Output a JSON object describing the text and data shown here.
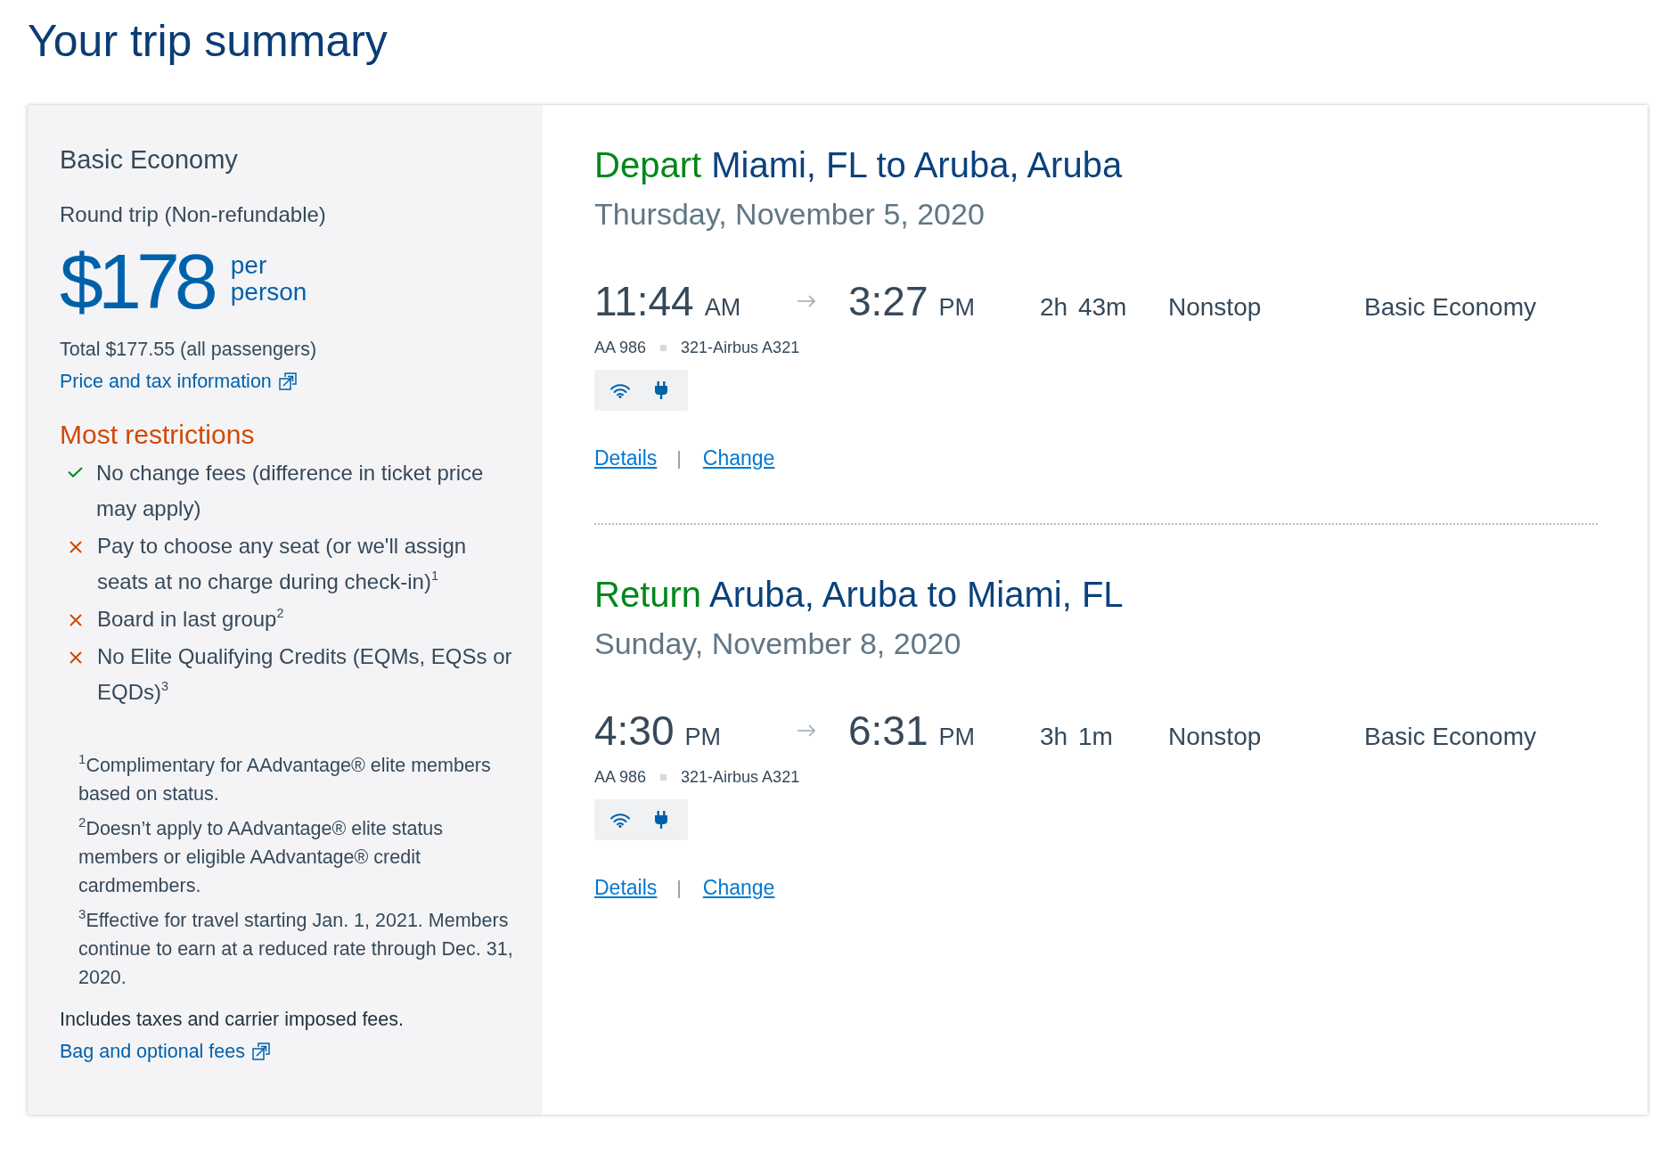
{
  "page": {
    "title": "Your trip summary"
  },
  "fare": {
    "name": "Basic Economy",
    "trip_type": "Round trip (Non-refundable)",
    "price": "$178",
    "price_unit": "per person",
    "total": "Total $177.55 (all passengers)",
    "price_link": "Price and tax information",
    "restrictions": {
      "title": "Most restrictions",
      "items": [
        {
          "text": "No change fees (difference in ticket price may apply)",
          "included": true
        },
        {
          "text": "Pay to choose any seat (or we'll assign seats at no charge during check-in)$^{1}$",
          "included": false
        },
        {
          "text": "Board in last group$^{2}$",
          "included": false
        },
        {
          "text": "No Elite Qualifying Credits (EQMs, EQSs or EQDs)$^{3}$",
          "included": false
        }
      ]
    },
    "footnotes": [
      "$^{1}$Complimentary for AAdvantage® elite members based on status.",
      "$^{2}$Doesn’t apply to AAdvantage® elite status members or eligible AAdvantage® credit cardmembers.",
      "$^{3}$Effective for travel starting Jan. 1, 2021. Members continue to earn at a reduced rate through Dec. 31, 2020."
    ],
    "note": "Includes taxes and carrier imposed fees.",
    "fees_link": "Bag and optional fees"
  },
  "flights": [
    {
      "direction": "Depart",
      "route": "Miami, FL to Aruba, Aruba",
      "date": "Thursday, November 5, 2020",
      "depart": {
        "time": "11:44",
        "period": "AM"
      },
      "arrive": {
        "time": "3:27",
        "period": "PM"
      },
      "duration": "2h 43m",
      "stops": "Nonstop",
      "cabin": "Basic Economy",
      "flight_number": "AA 986",
      "aircraft": "321-Airbus A321",
      "amenities": [
        {
          "kind": "wifi"
        },
        {
          "kind": "power"
        }
      ],
      "links": [
        "Details",
        "Change"
      ]
    },
    {
      "direction": "Return",
      "route": "Aruba, Aruba to Miami, FL",
      "date": "Sunday, November 8, 2020",
      "depart": {
        "time": "4:30",
        "period": "PM"
      },
      "arrive": {
        "time": "6:31",
        "period": "PM"
      },
      "duration": "3h 1m",
      "stops": "Nonstop",
      "cabin": "Basic Economy",
      "flight_number": "AA 986",
      "aircraft": "321-Airbus A321",
      "amenities": [
        {
          "kind": "wifi"
        },
        {
          "kind": "power"
        }
      ],
      "links": [
        "Details",
        "Change"
      ]
    }
  ]
}
